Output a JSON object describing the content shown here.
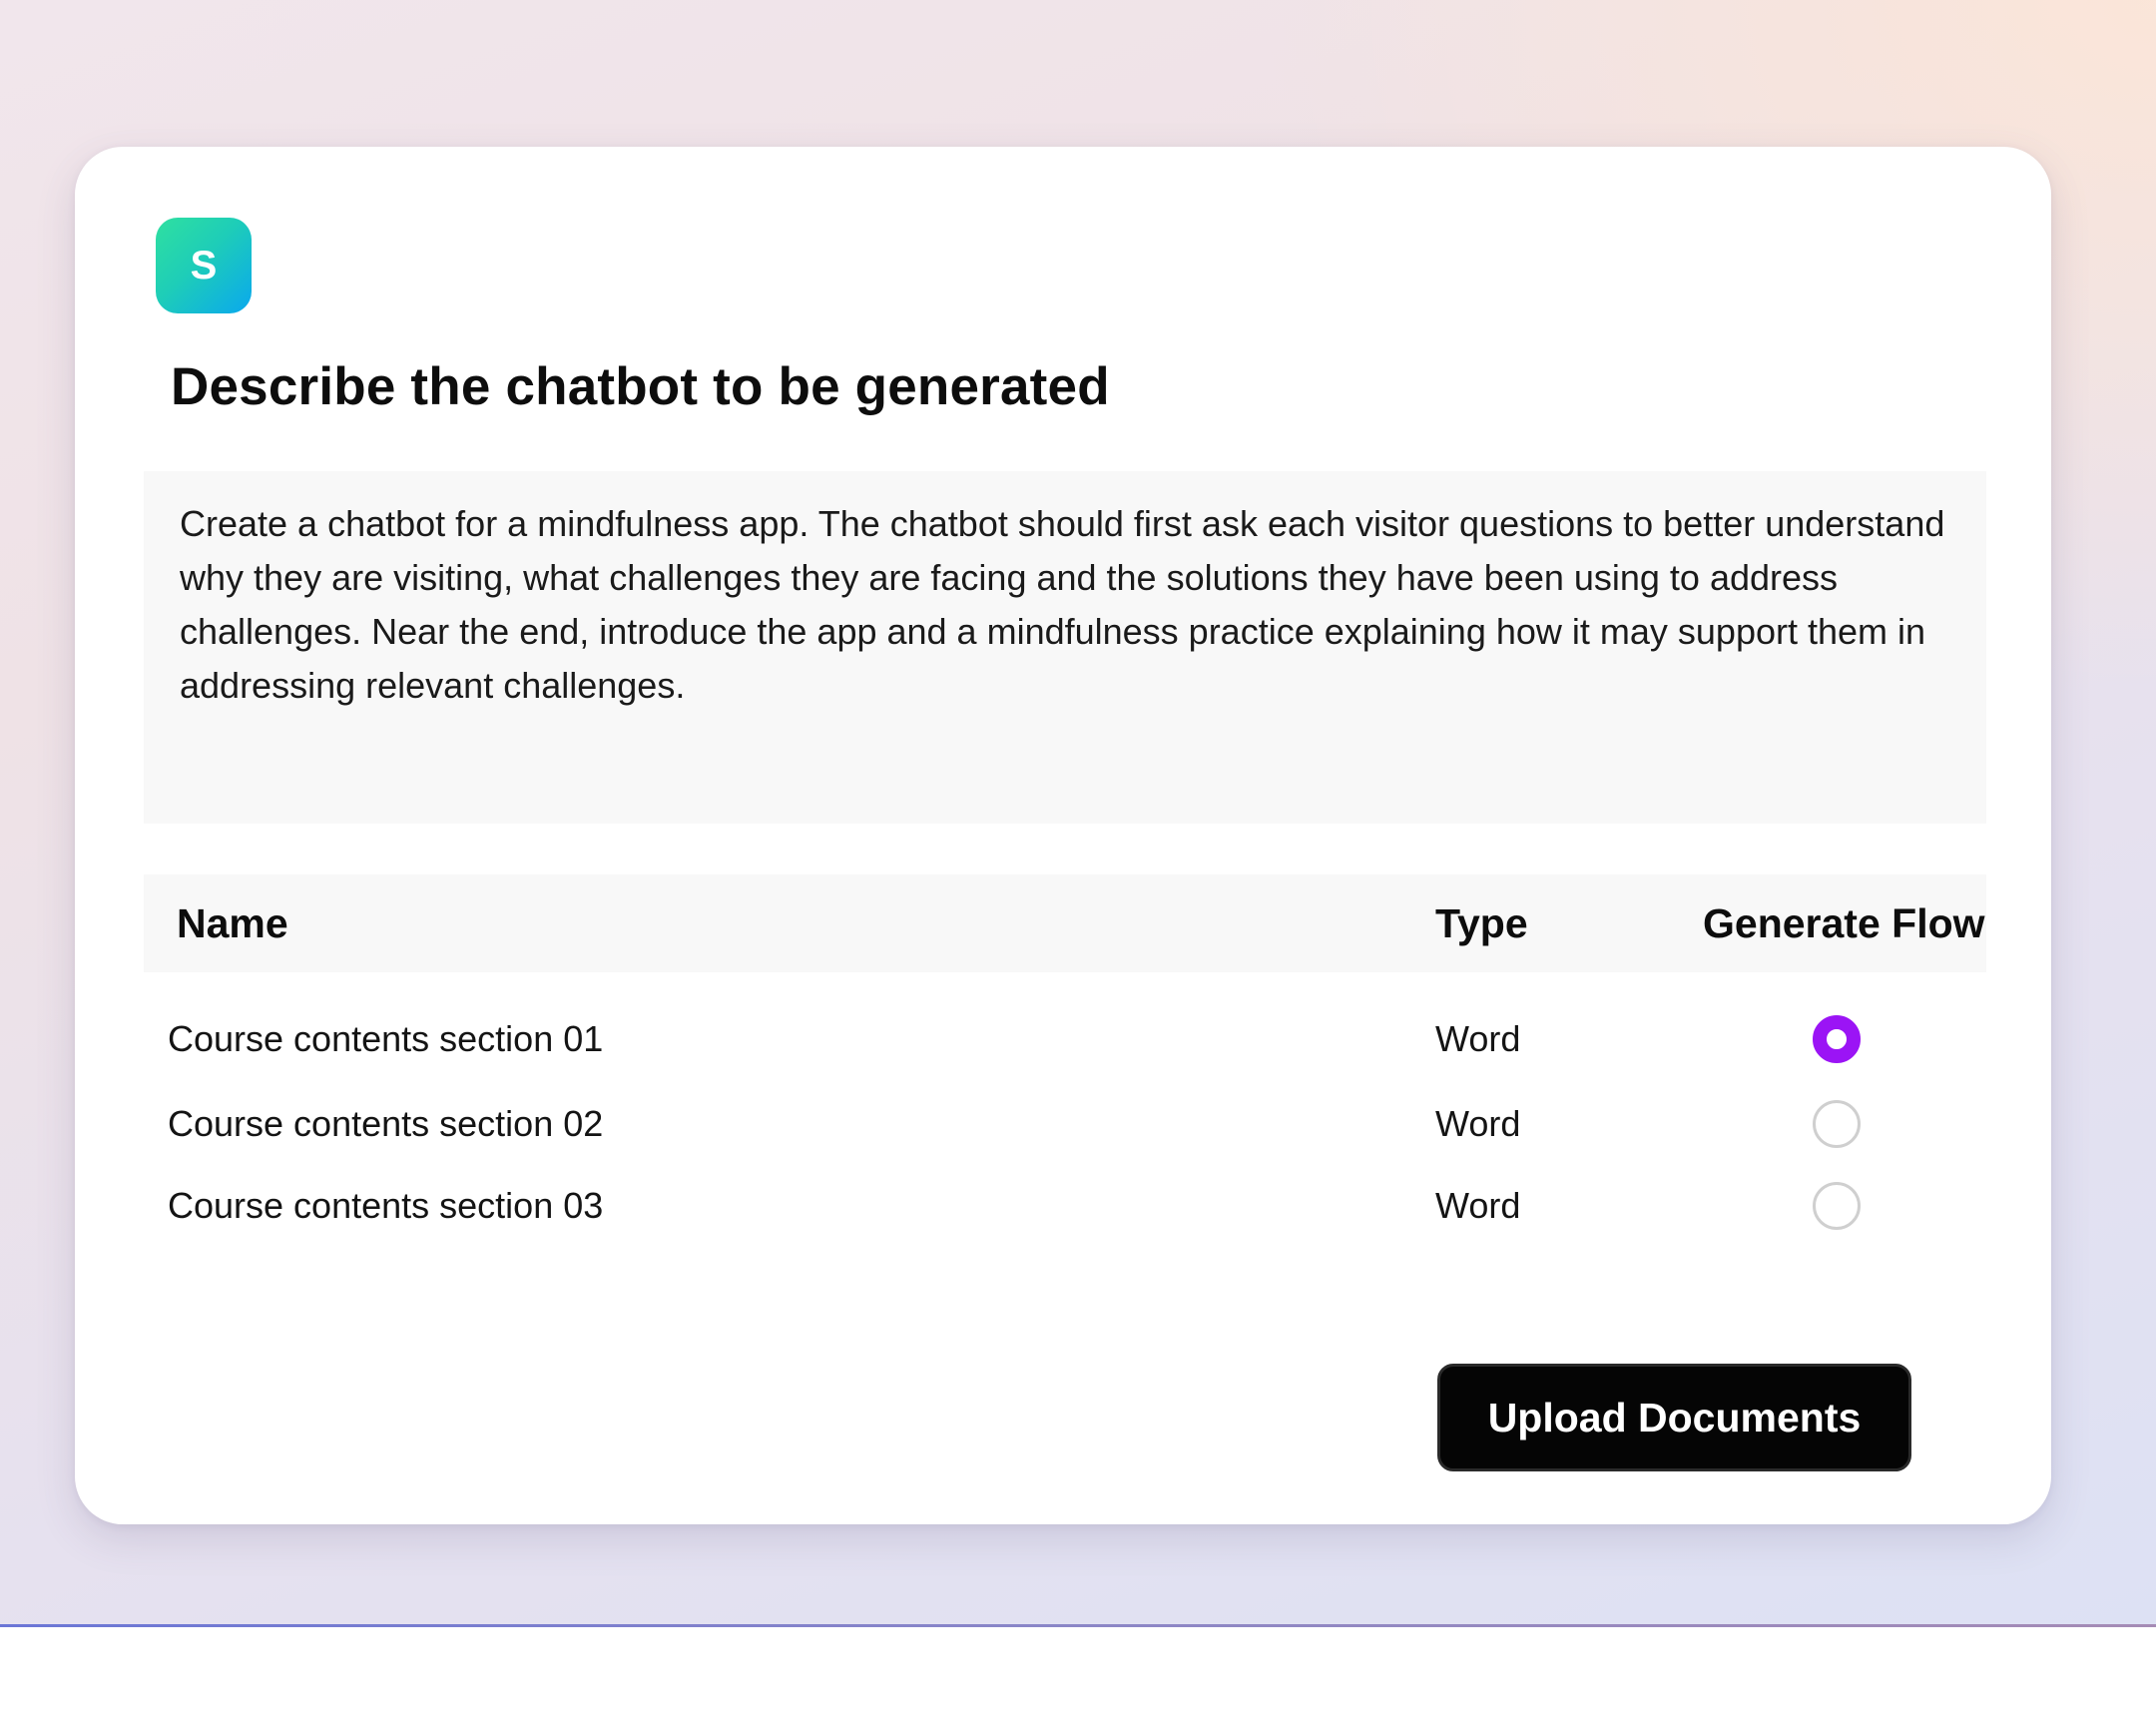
{
  "app": {
    "logo_letter": "S"
  },
  "form": {
    "title": "Describe the chatbot to be generated",
    "prompt_text": "Create a chatbot for a mindfulness app. The chatbot should first ask each visitor questions to better understand why they are visiting, what challenges they are facing and the solutions they have been using to address challenges. Near the end, introduce the app and a mindfulness practice explaining how it may support them in addressing relevant challenges."
  },
  "table": {
    "columns": [
      "Name",
      "Type",
      "Generate Flow"
    ],
    "rows": [
      {
        "name": "Course contents section 01",
        "type": "Word",
        "selected": true
      },
      {
        "name": "Course contents section 02",
        "type": "Word",
        "selected": false
      },
      {
        "name": "Course contents section 03",
        "type": "Word",
        "selected": false
      }
    ]
  },
  "actions": {
    "upload_label": "Upload Documents"
  },
  "colors": {
    "accent": "#9b14f5",
    "button_bg": "#050505",
    "logo_gradient_start": "#2fe0a0",
    "logo_gradient_end": "#0aa8ee"
  }
}
